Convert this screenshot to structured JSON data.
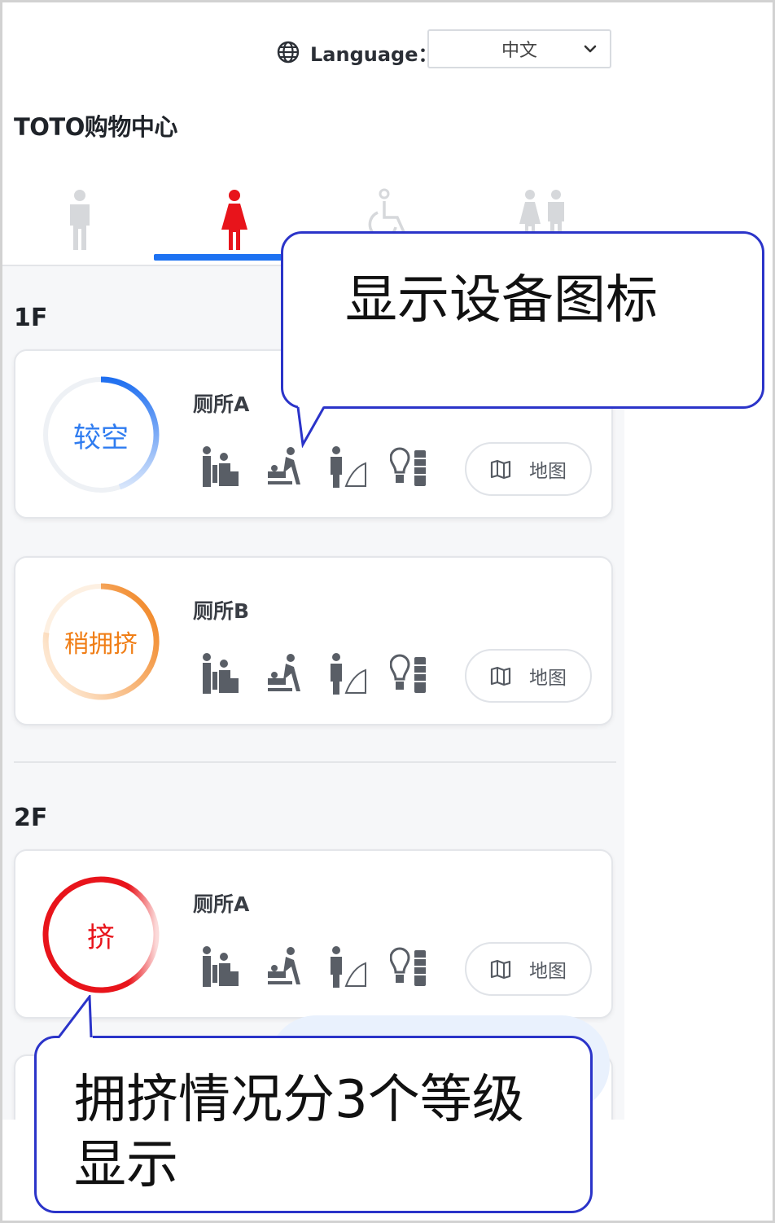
{
  "language": {
    "label": "Language：",
    "selected": "中文"
  },
  "mall_title": "TOTO购物中心",
  "tabs": [
    {
      "name": "male",
      "active": false
    },
    {
      "name": "female",
      "active": true
    },
    {
      "name": "accessible",
      "active": false
    },
    {
      "name": "family",
      "active": false
    }
  ],
  "floors": [
    {
      "label": "1F",
      "restrooms": [
        {
          "name": "厕所A",
          "status": "较空",
          "status_color": "#2f7cf0",
          "map_label": "地图"
        },
        {
          "name": "厕所B",
          "status": "稍拥挤",
          "status_color": "#f07e16",
          "map_label": "地图"
        }
      ]
    },
    {
      "label": "2F",
      "restrooms": [
        {
          "name": "厕所A",
          "status": "挤",
          "status_color": "#e8141b",
          "map_label": "地图"
        }
      ]
    }
  ],
  "facility_icons": [
    "child-seat-icon",
    "baby-changing-icon",
    "fitting-board-icon",
    "ostomate-icon"
  ],
  "annotations": {
    "equipment": "显示设备图标",
    "congestion_line1": "拥挤情况分3个等级",
    "congestion_line2": "显示"
  }
}
